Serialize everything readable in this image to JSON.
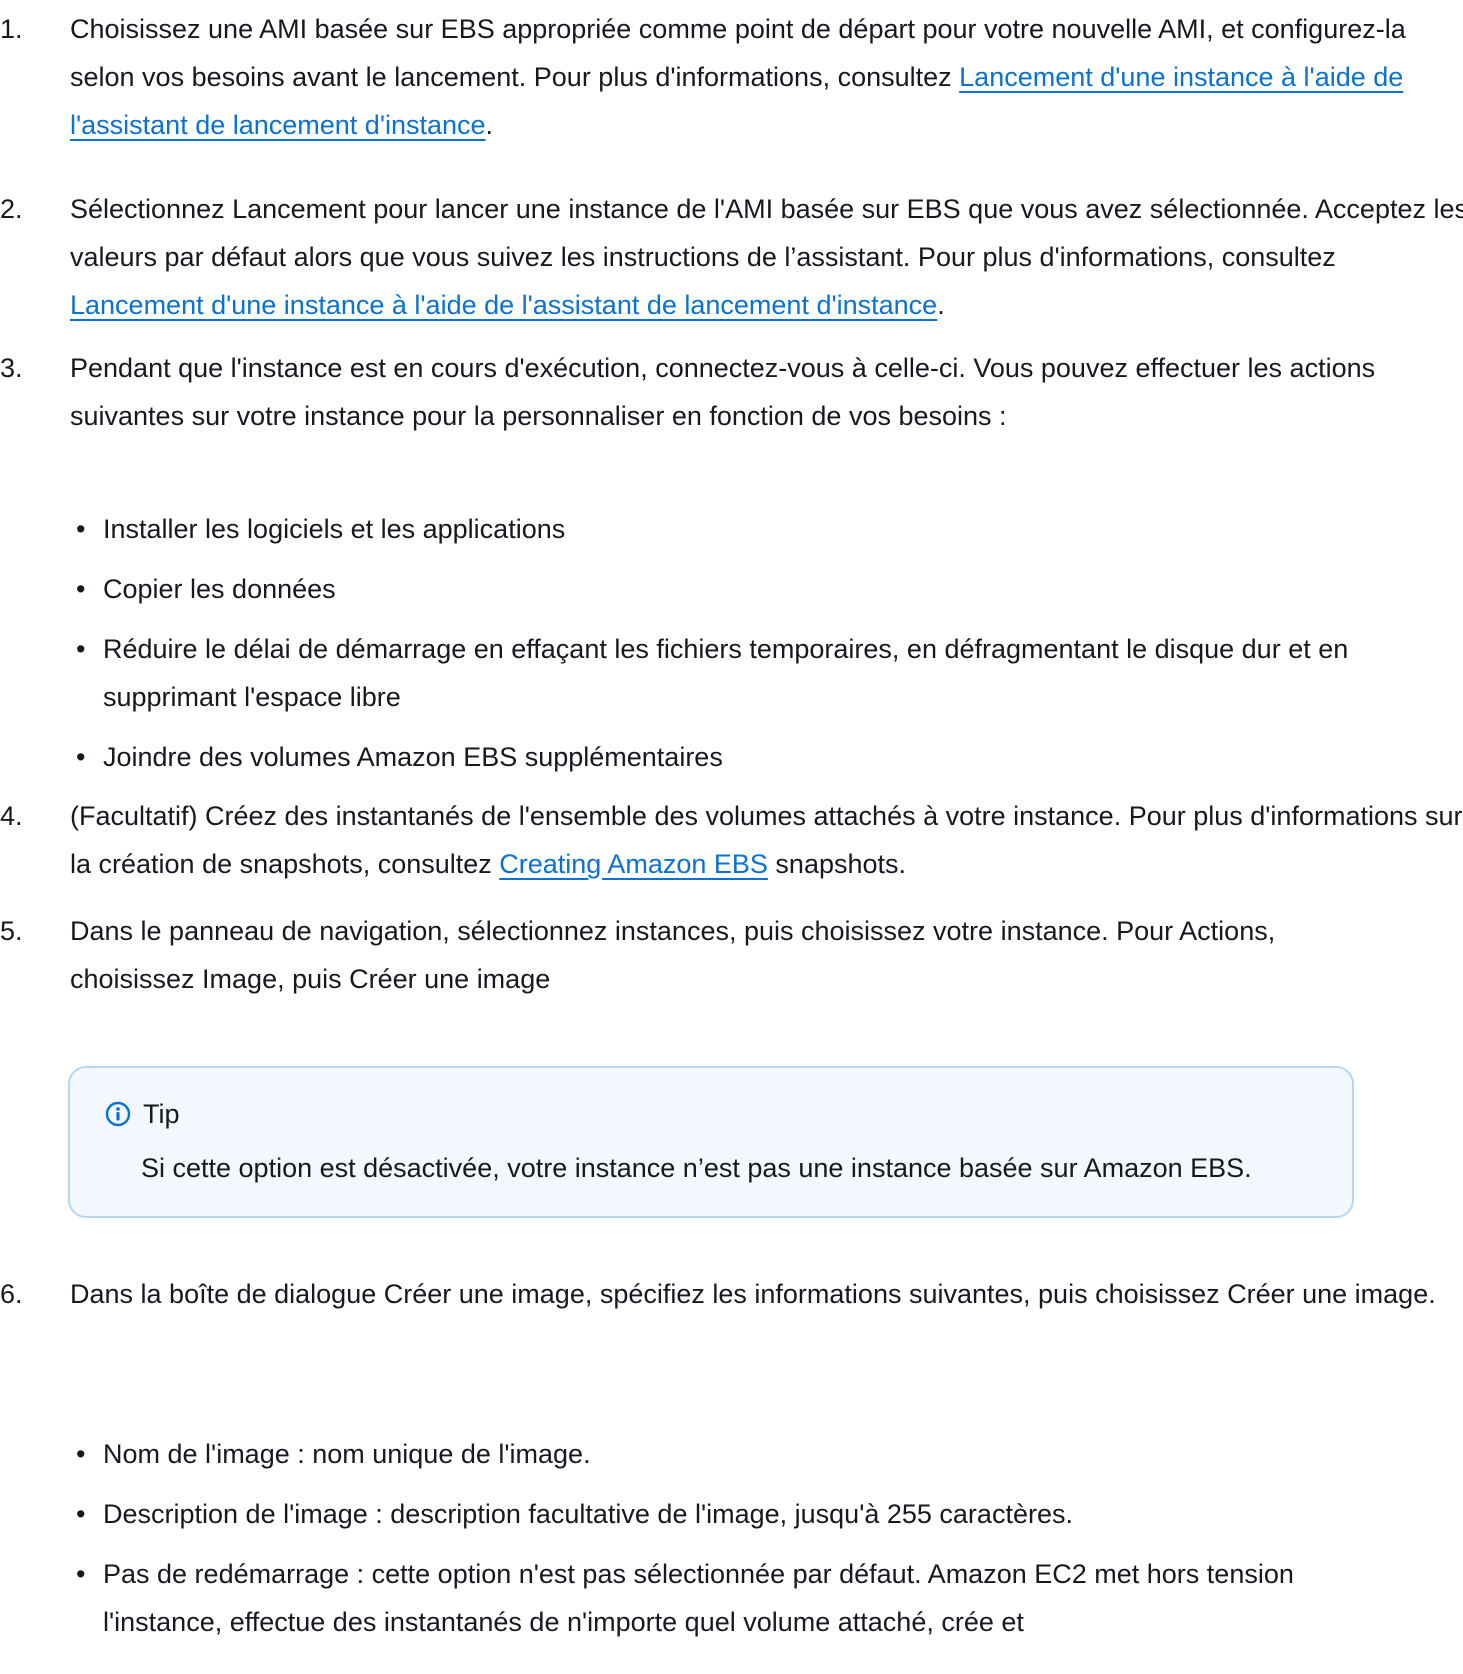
{
  "steps": [
    {
      "num": "1.",
      "pre": "Choisissez une AMI basée sur EBS appropriée comme point de départ pour votre nouvelle AMI, et configurez-la selon vos besoins avant le lancement. Pour plus d'informations, consultez ",
      "link": "Lancement d'une instance à l'aide de l'assistant de lancement d'instance",
      "post": "."
    },
    {
      "num": "2.",
      "pre": "Sélectionnez Lancement pour lancer une instance de l'AMI basée sur EBS que vous avez sélectionnée. Acceptez les valeurs par défaut alors que vous suivez les instructions de l’assistant. Pour plus d'informations, consultez ",
      "link": "Lancement d'une instance à l'aide de l'assistant de lancement d'instance",
      "post": "."
    },
    {
      "num": "3.",
      "text": "Pendant que l'instance est en cours d'exécution, connectez-vous à celle-ci. Vous pouvez effectuer les actions suivantes sur votre instance pour la personnaliser en fonction de vos besoins :",
      "bullets": [
        "Installer les logiciels et les applications",
        "Copier les données",
        "Réduire le délai de démarrage en effaçant les fichiers temporaires, en défragmentant le disque dur et en supprimant l'espace libre",
        "Joindre des volumes Amazon EBS supplémentaires"
      ]
    },
    {
      "num": "4.",
      "pre": "(Facultatif) Créez des instantanés de l'ensemble des volumes attachés à votre instance. Pour plus d'informations sur la création de snapshots, consultez ",
      "link": "Creating Amazon EBS",
      "post": " snapshots."
    },
    {
      "num": "5.",
      "text": "Dans le panneau de navigation, sélectionnez instances, puis choisissez votre instance. Pour Actions, choisissez Image, puis Créer une image"
    },
    {
      "num": "6.",
      "text": "Dans la boîte de dialogue Créer une image, spécifiez les informations suivantes, puis choisissez Créer une image.",
      "bullets": [
        "Nom de l'image : nom unique de l'image.",
        "Description de l'image : description facultative de l'image, jusqu'à 255 caractères.",
        "Pas de redémarrage : cette option n'est pas sélectionnée par défaut. Amazon EC2 met hors tension l'instance, effectue des instantanés de n'importe quel volume attaché, crée et"
      ]
    }
  ],
  "tip": {
    "title": "Tip",
    "body": "Si cette option est désactivée, votre instance n’est pas une instance basée sur Amazon EBS.",
    "icon": "info-icon",
    "border_color": "#b4d7f3",
    "background": "#f2f8fd",
    "icon_color": "#0972d3"
  },
  "colors": {
    "text": "#16191f",
    "link": "#0972d3"
  }
}
